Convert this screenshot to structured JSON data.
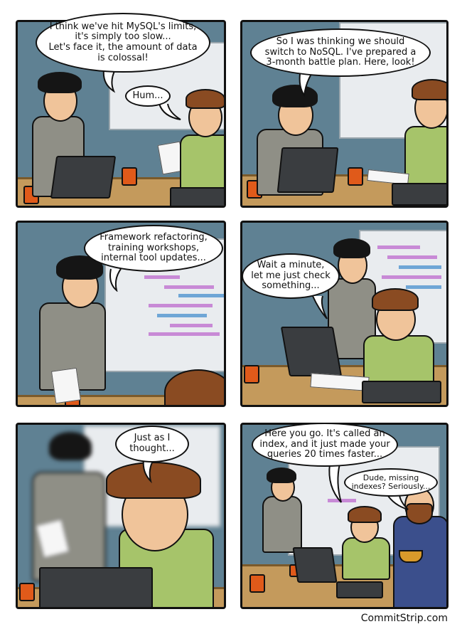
{
  "comic": {
    "panels": [
      {
        "id": "panel-1",
        "bubbles": [
          {
            "speaker": "dark-haired-dev",
            "text": "I think we've hit MySQL's limits,\nit's simply too slow...\nLet's face it, the amount of data\nis colossal!"
          },
          {
            "speaker": "brown-haired-dev",
            "text": "Hum..."
          }
        ]
      },
      {
        "id": "panel-2",
        "bubbles": [
          {
            "speaker": "dark-haired-dev",
            "text": "So I was thinking we should\nswitch to NoSQL. I've prepared a\n3-month battle plan. Here, look!"
          }
        ]
      },
      {
        "id": "panel-3",
        "bubbles": [
          {
            "speaker": "dark-haired-dev",
            "text": "Framework refactoring,\ntraining workshops,\ninternal tool updates..."
          }
        ]
      },
      {
        "id": "panel-4",
        "bubbles": [
          {
            "speaker": "brown-haired-dev",
            "text": "Wait a minute,\nlet me just check\nsomething..."
          }
        ]
      },
      {
        "id": "panel-5",
        "bubbles": [
          {
            "speaker": "brown-haired-dev",
            "text": "Just as I\nthought..."
          }
        ]
      },
      {
        "id": "panel-6",
        "bubbles": [
          {
            "speaker": "brown-haired-dev",
            "text": "Here you go. It's called an\nindex, and it just made your\nqueries 20 times faster..."
          },
          {
            "speaker": "bearded-dev",
            "text": "Dude, missing\nindexes? Seriously..."
          }
        ]
      }
    ],
    "credit": "CommitStrip.com"
  },
  "colors": {
    "wall": "#5f8193",
    "table": "#c49a5c",
    "mug": "#e05a1a",
    "shirt_green": "#a6c46a",
    "vest_gray": "#8f8f86",
    "shirt_blue": "#3b4f8c"
  }
}
